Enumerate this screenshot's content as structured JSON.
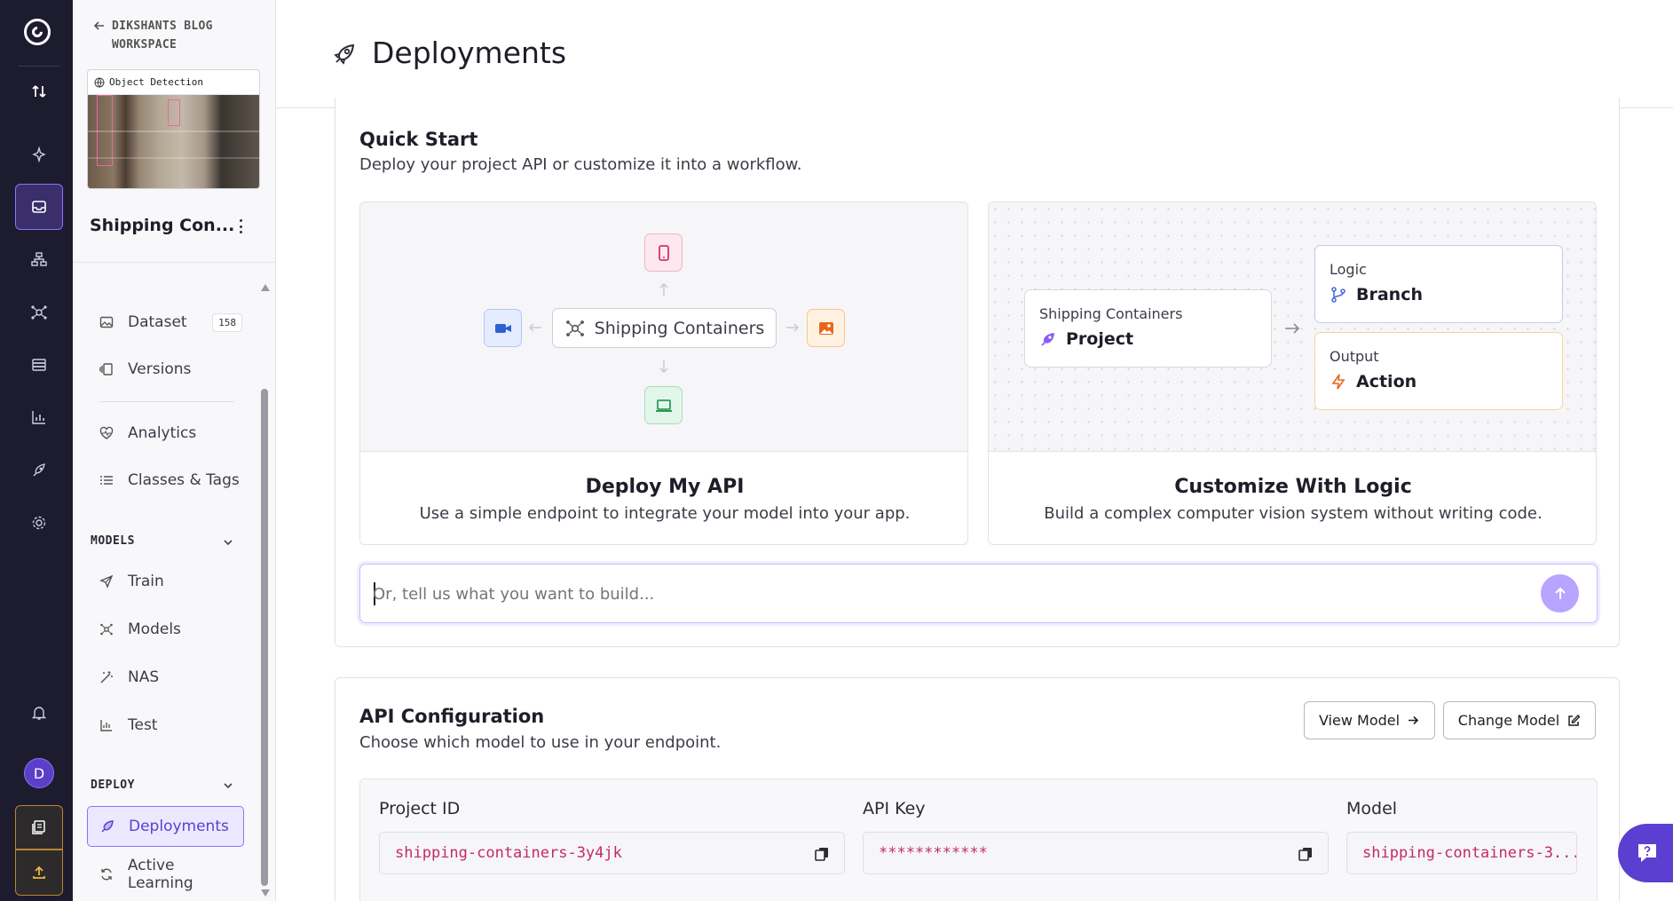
{
  "app": {
    "accent_color": "#8b72ff",
    "rail_bg": "#1d1b2e",
    "user_avatar_letter": "D"
  },
  "sidebar": {
    "back_label": "DIKSHANTS BLOG WORKSPACE",
    "project_type_badge": "Object Detection",
    "project_name": "Shipping Con...",
    "items": [
      {
        "label": "Dataset",
        "icon": "image-icon",
        "count": "158"
      },
      {
        "label": "Versions",
        "icon": "versions-icon"
      },
      {
        "label": "Analytics",
        "icon": "heart-pulse-icon"
      },
      {
        "label": "Classes & Tags",
        "icon": "list-icon"
      }
    ],
    "models_heading": "MODELS",
    "models_items": [
      {
        "label": "Train",
        "icon": "send-icon"
      },
      {
        "label": "Models",
        "icon": "nodes-icon"
      },
      {
        "label": "NAS",
        "icon": "wand-icon"
      },
      {
        "label": "Test",
        "icon": "chart-icon"
      }
    ],
    "deploy_heading": "DEPLOY",
    "deploy_items": [
      {
        "label": "Deployments",
        "icon": "rocket-icon",
        "active": true
      },
      {
        "label": "Active Learning",
        "icon": "refresh-icon"
      }
    ]
  },
  "page": {
    "title": "Deployments"
  },
  "quick_start": {
    "title": "Quick Start",
    "subtitle": "Deploy your project API or customize it into a workflow.",
    "deploy_card": {
      "center_node": "Shipping Containers",
      "title": "Deploy My API",
      "description": "Use a simple endpoint to integrate your model into your app."
    },
    "logic_card": {
      "project_node_label": "Shipping Containers",
      "project_node_title": "Project",
      "logic_node_label": "Logic",
      "logic_node_title": "Branch",
      "output_node_label": "Output",
      "output_node_title": "Action",
      "title": "Customize With Logic",
      "description": "Build a complex computer vision system without writing code."
    },
    "prompt_placeholder": "Or, tell us what you want to build..."
  },
  "api_config": {
    "title": "API Configuration",
    "subtitle": "Choose which model to use in your endpoint.",
    "view_model_label": "View Model",
    "change_model_label": "Change Model",
    "project_id_label": "Project ID",
    "project_id_value": "shipping-containers-3y4jk",
    "api_key_label": "API Key",
    "api_key_value": "************",
    "model_label": "Model",
    "model_value": "shipping-containers-3..."
  }
}
